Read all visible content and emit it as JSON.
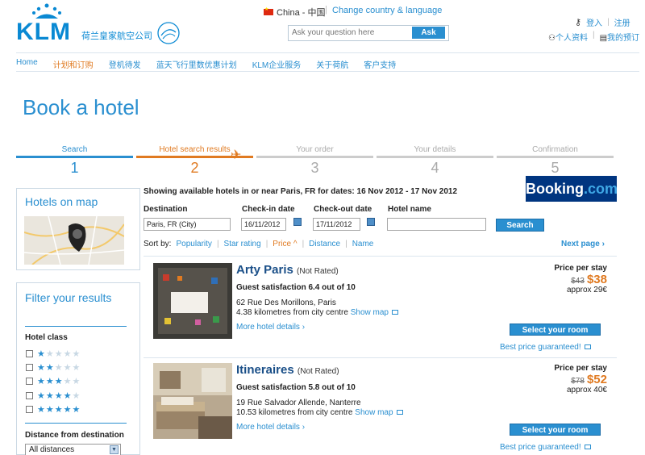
{
  "header": {
    "logo_text": "KLM",
    "logo_cn": "荷兰皇家航空公司",
    "country": "China - 中国",
    "change_link": "Change country & language",
    "search_placeholder": "Ask your question here",
    "ask_label": "Ask",
    "login": "登入",
    "register": "注册",
    "profile": "个人资料",
    "booking_mgmt": "我的预订"
  },
  "nav": [
    "Home",
    "计划和订购",
    "登机待发",
    "蓝天飞行里数优惠计划",
    "KLM企业服务",
    "关于荷航",
    "客户支持"
  ],
  "page_title": "Book a hotel",
  "steps": [
    {
      "label": "Search",
      "num": "1"
    },
    {
      "label": "Hotel search results",
      "num": "2"
    },
    {
      "label": "Your order",
      "num": "3"
    },
    {
      "label": "Your details",
      "num": "4"
    },
    {
      "label": "Confirmation",
      "num": "5"
    }
  ],
  "sidebar": {
    "map_title": "Hotels on map",
    "filter_title": "Filter your results",
    "hotel_class": "Hotel class",
    "star_levels": [
      1,
      2,
      3,
      4,
      5
    ],
    "distance_title": "Distance from destination",
    "distance_value": "All distances"
  },
  "search": {
    "showing": "Showing available hotels in or near Paris, FR for dates: 16 Nov 2012 - 17 Nov 2012",
    "booking_logo": "Booking",
    "booking_logo_suffix": ".com",
    "destination_label": "Destination",
    "destination_value": "Paris, FR (City)",
    "checkin_label": "Check-in date",
    "checkin_value": "16/11/2012",
    "checkout_label": "Check-out date",
    "checkout_value": "17/11/2012",
    "hotelname_label": "Hotel name",
    "hotelname_value": "",
    "search_button": "Search",
    "sort_by": "Sort by:",
    "sort_options": [
      "Popularity",
      "Star rating",
      "Price ^",
      "Distance",
      "Name"
    ],
    "next_page": "Next page ›"
  },
  "hotels": [
    {
      "name": "Arty Paris",
      "rated": "(Not Rated)",
      "satisfaction": "Guest satisfaction 6.4 out of 10",
      "address": "62 Rue Des Morillons, Paris",
      "distance": "4.38 kilometres from city centre",
      "show_map": "Show map",
      "more": "More hotel details ›",
      "price_label": "Price per stay",
      "old_price": "$43",
      "new_price": "$38",
      "approx": "approx 29€",
      "select": "Select your room",
      "best": "Best price guaranteed!"
    },
    {
      "name": "Itineraires",
      "rated": "(Not Rated)",
      "satisfaction": "Guest satisfaction 5.8 out of 10",
      "address": "19 Rue Salvador Allende, Nanterre",
      "distance": "10.53 kilometres from city centre",
      "show_map": "Show map",
      "more": "More hotel details ›",
      "price_label": "Price per stay",
      "old_price": "$78",
      "new_price": "$52",
      "approx": "approx 40€",
      "select": "Select your room",
      "best": "Best price guaranteed!"
    }
  ],
  "colors": {
    "brand_blue": "#2a8fd0",
    "accent_orange": "#e07a21",
    "booking_navy": "#003580"
  }
}
